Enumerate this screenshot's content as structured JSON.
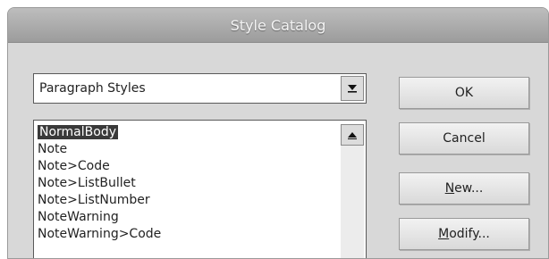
{
  "window": {
    "title": "Style Catalog"
  },
  "style_category": {
    "value": "Paragraph Styles"
  },
  "style_list": {
    "items": [
      {
        "label": "NormalBody",
        "selected": true
      },
      {
        "label": "Note"
      },
      {
        "label": "Note>Code"
      },
      {
        "label": "Note>ListBullet"
      },
      {
        "label": "Note>ListNumber"
      },
      {
        "label": "NoteWarning"
      },
      {
        "label": "NoteWarning>Code"
      }
    ]
  },
  "buttons": {
    "ok": "OK",
    "cancel": "Cancel",
    "new_mnemonic": "N",
    "new_rest": "ew...",
    "modify_mnemonic": "M",
    "modify_rest": "odify..."
  },
  "icons": {
    "combo_arrow": "chevron-down-icon",
    "scroll_up": "scroll-up-arrow-icon"
  }
}
